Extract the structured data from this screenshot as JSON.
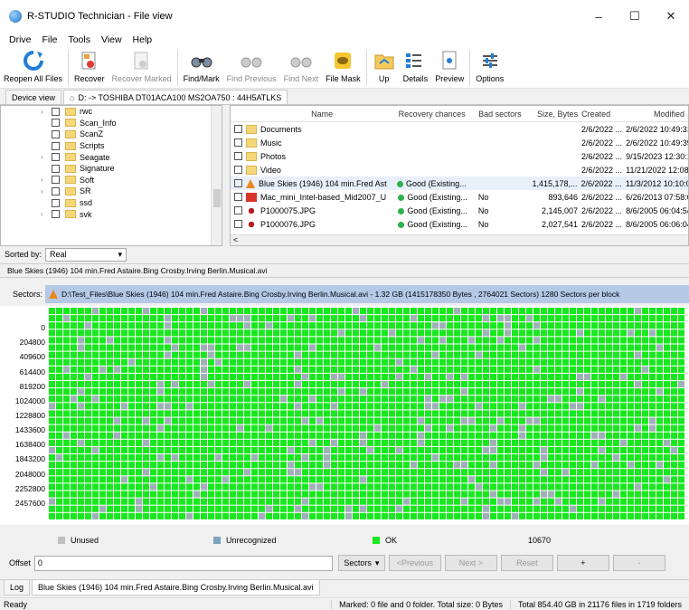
{
  "window": {
    "title": "R-STUDIO Technician - File view",
    "minimize": "–",
    "maximize": "☐",
    "close": "✕"
  },
  "menu": [
    "Drive",
    "File",
    "Tools",
    "View",
    "Help"
  ],
  "toolbar": [
    {
      "label": "Reopen All Files",
      "icon": "reopen-icon",
      "enabled": true
    },
    {
      "label": "Recover",
      "icon": "recover-icon",
      "enabled": true
    },
    {
      "label": "Recover Marked",
      "icon": "recover-marked-icon",
      "enabled": false
    },
    {
      "label": "Find/Mark",
      "icon": "binoculars-icon",
      "enabled": true
    },
    {
      "label": "Find Previous",
      "icon": "find-previous-icon",
      "enabled": false
    },
    {
      "label": "Find Next",
      "icon": "find-next-icon",
      "enabled": false
    },
    {
      "label": "File Mask",
      "icon": "file-mask-icon",
      "enabled": true
    },
    {
      "label": "Up",
      "icon": "folder-up-icon",
      "enabled": true
    },
    {
      "label": "Details",
      "icon": "details-icon",
      "enabled": true
    },
    {
      "label": "Preview",
      "icon": "preview-icon",
      "enabled": true
    },
    {
      "label": "Options",
      "icon": "options-icon",
      "enabled": true
    }
  ],
  "tabs": {
    "device_view": "Device view",
    "path_tab": "D: -> TOSHIBA DT01ACA100 MS2OA750 : 44H5ATLKS"
  },
  "tree": {
    "items": [
      {
        "label": "rwc",
        "expandable": true
      },
      {
        "label": "Scan_Info",
        "expandable": false
      },
      {
        "label": "ScanZ",
        "expandable": false
      },
      {
        "label": "Scripts",
        "expandable": false
      },
      {
        "label": "Seagate",
        "expandable": true
      },
      {
        "label": "Signature",
        "expandable": false
      },
      {
        "label": "Soft",
        "expandable": true
      },
      {
        "label": "SR",
        "expandable": true
      },
      {
        "label": "ssd",
        "expandable": false
      },
      {
        "label": "svk",
        "expandable": true
      }
    ],
    "sorted_by_label": "Sorted by:",
    "sorted_by_value": "Real"
  },
  "files": {
    "columns": [
      "Name",
      "Recovery chances",
      "Bad sectors",
      "Size, Bytes",
      "Created",
      "Modified"
    ],
    "rows": [
      {
        "name": "Documents",
        "type": "folder",
        "recovery": "",
        "bad": "",
        "size": "",
        "created": "2/6/2022 ...",
        "modified": "2/6/2022 10:49:31 I"
      },
      {
        "name": "Music",
        "type": "folder",
        "recovery": "",
        "bad": "",
        "size": "",
        "created": "2/6/2022 ...",
        "modified": "2/6/2022 10:49:39 I"
      },
      {
        "name": "Photos",
        "type": "folder",
        "recovery": "",
        "bad": "",
        "size": "",
        "created": "2/6/2022 ...",
        "modified": "9/15/2023 12:30:10"
      },
      {
        "name": "Video",
        "type": "folder",
        "recovery": "",
        "bad": "",
        "size": "",
        "created": "2/6/2022 ...",
        "modified": "11/21/2022 12:08:3"
      },
      {
        "name": "Blue Skies (1946) 104 min.Fred Ast",
        "type": "vlc",
        "recovery": "Good (Existing...",
        "bad": "",
        "size": "1,415,178,...",
        "created": "2/6/2022 ...",
        "modified": "11/3/2012 10:10:07"
      },
      {
        "name": "Mac_mini_Intel-based_Mid2007_U",
        "type": "pdf",
        "recovery": "Good (Existing...",
        "bad": "No",
        "size": "893,646",
        "created": "2/6/2022 ...",
        "modified": "6/26/2013 07:58:08"
      },
      {
        "name": "P1000075.JPG",
        "type": "jpg",
        "recovery": "Good (Existing...",
        "bad": "No",
        "size": "2,145,007",
        "created": "2/6/2022 ...",
        "modified": "8/6/2005 06:04:54 /"
      },
      {
        "name": "P1000076.JPG",
        "type": "jpg",
        "recovery": "Good (Existing...",
        "bad": "No",
        "size": "2,027,541",
        "created": "2/6/2022 ...",
        "modified": "8/6/2005 06:06:04 /"
      }
    ]
  },
  "selected_path": "Blue Skies (1946) 104 min.Fred Astaire.Bing Crosby.Irving Berlin.Musical.avi",
  "sectors": {
    "label": "Sectors:",
    "info": "D:\\Test_Files\\Blue Skies (1946) 104 min.Fred Astaire.Bing Crosby.Irving Berlin.Musical.avi - 1.32 GB (1415178350 Bytes , 2764021 Sectors) 1280 Sectors per block",
    "offsets": [
      "0",
      "204800",
      "409600",
      "614400",
      "819200",
      "1024000",
      "1228800",
      "1433600",
      "1638400",
      "1843200",
      "2048000",
      "2252800",
      "2457600"
    ]
  },
  "legend": {
    "unused": "Unused",
    "unrecognized": "Unrecognized",
    "ok": "OK",
    "ok_count": "10670",
    "colors": {
      "unused": "#c0c0c0",
      "unrecognized": "#7fa3b8",
      "ok": "#19e81f",
      "grey_block": "#9fb0b8"
    }
  },
  "offsetbar": {
    "label": "Offset",
    "value": "0",
    "sectors": "Sectors",
    "previous": "<Previous",
    "next": "Next >",
    "reset": "Reset",
    "plus": "+",
    "minus": "-"
  },
  "bottom_tabs": [
    "Log",
    "Blue Skies (1946) 104 min.Fred Astaire.Bing Crosby.Irving Berlin.Musical.avi"
  ],
  "status": {
    "ready": "Ready",
    "marked": "Marked: 0 file and 0 folder. Total size: 0 Bytes",
    "total": "Total 854.40 GB in 21176 files in 1719 folders"
  }
}
